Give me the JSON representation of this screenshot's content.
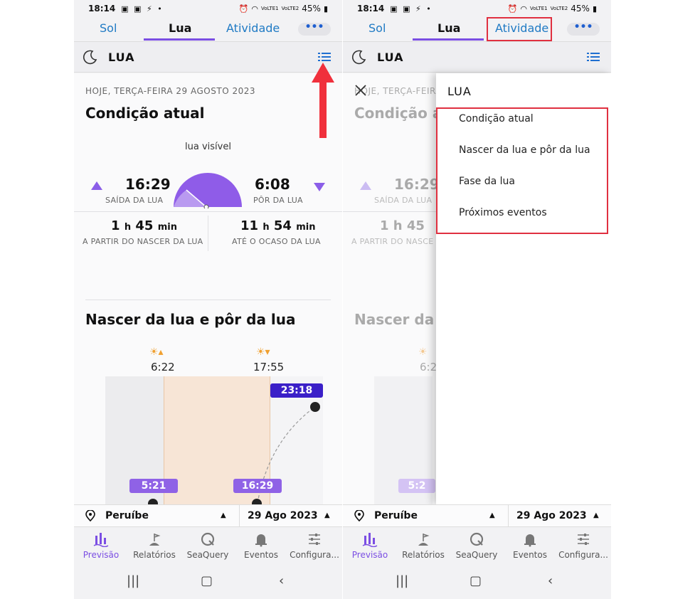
{
  "status": {
    "time": "18:14",
    "battery": "45%",
    "net1": "VoLTE1",
    "net2": "VoLTE2"
  },
  "tabs": [
    {
      "label": "Sol"
    },
    {
      "label": "Lua"
    },
    {
      "label": "Atividade"
    }
  ],
  "more_label": "•••",
  "section": {
    "title": "LUA"
  },
  "current": {
    "date": "HOJE, TERÇA-FEIRA 29 AGOSTO 2023",
    "title": "Condição atual",
    "visibility": "lua visível",
    "rise_time": "16:29",
    "rise_label": "SAÍDA DA LUA",
    "set_time": "6:08",
    "set_label": "PÔR DA LUA",
    "since_h": "1",
    "since_m": "45",
    "since_label": "A PARTIR DO NASCER DA LUA",
    "until_h": "11",
    "until_m": "54",
    "until_label": "ATÉ O OCASO DA LUA",
    "unit_h": "h",
    "unit_m": "min"
  },
  "riseset": {
    "title": "Nascer da lua e pôr da lua",
    "sunrise": "6:22",
    "sunset": "17:55",
    "chip_top": "23:18",
    "chip_left": "5:21",
    "chip_mid": "16:29"
  },
  "location": {
    "city": "Peruíbe",
    "date": "29 Ago 2023"
  },
  "bottom_nav": [
    {
      "label": "Previsão"
    },
    {
      "label": "Relatórios"
    },
    {
      "label": "SeaQuery"
    },
    {
      "label": "Eventos"
    },
    {
      "label": "Configura..."
    }
  ],
  "drawer": {
    "title": "LUA",
    "items": [
      {
        "label": "Condição atual"
      },
      {
        "label": "Nascer da lua e pôr da lua"
      },
      {
        "label": "Fase da lua"
      },
      {
        "label": "Próximos eventos"
      }
    ]
  },
  "partial": {
    "date": "HOJE, TERÇA-FEIRA",
    "title": "Condição a",
    "rise_time": "16:29",
    "rise_label": "SAÍDA DA LUA",
    "dur": "1 h 45",
    "dur_label": "A PARTIR DO NASCE",
    "rs_title": "Nascer da l",
    "sunrise": "6:2",
    "chip": "5:2"
  },
  "colors": {
    "accent": "#7b4ee3",
    "link": "#1f7ac4",
    "highlight": "#e03040",
    "arrow": "#f0303c"
  }
}
